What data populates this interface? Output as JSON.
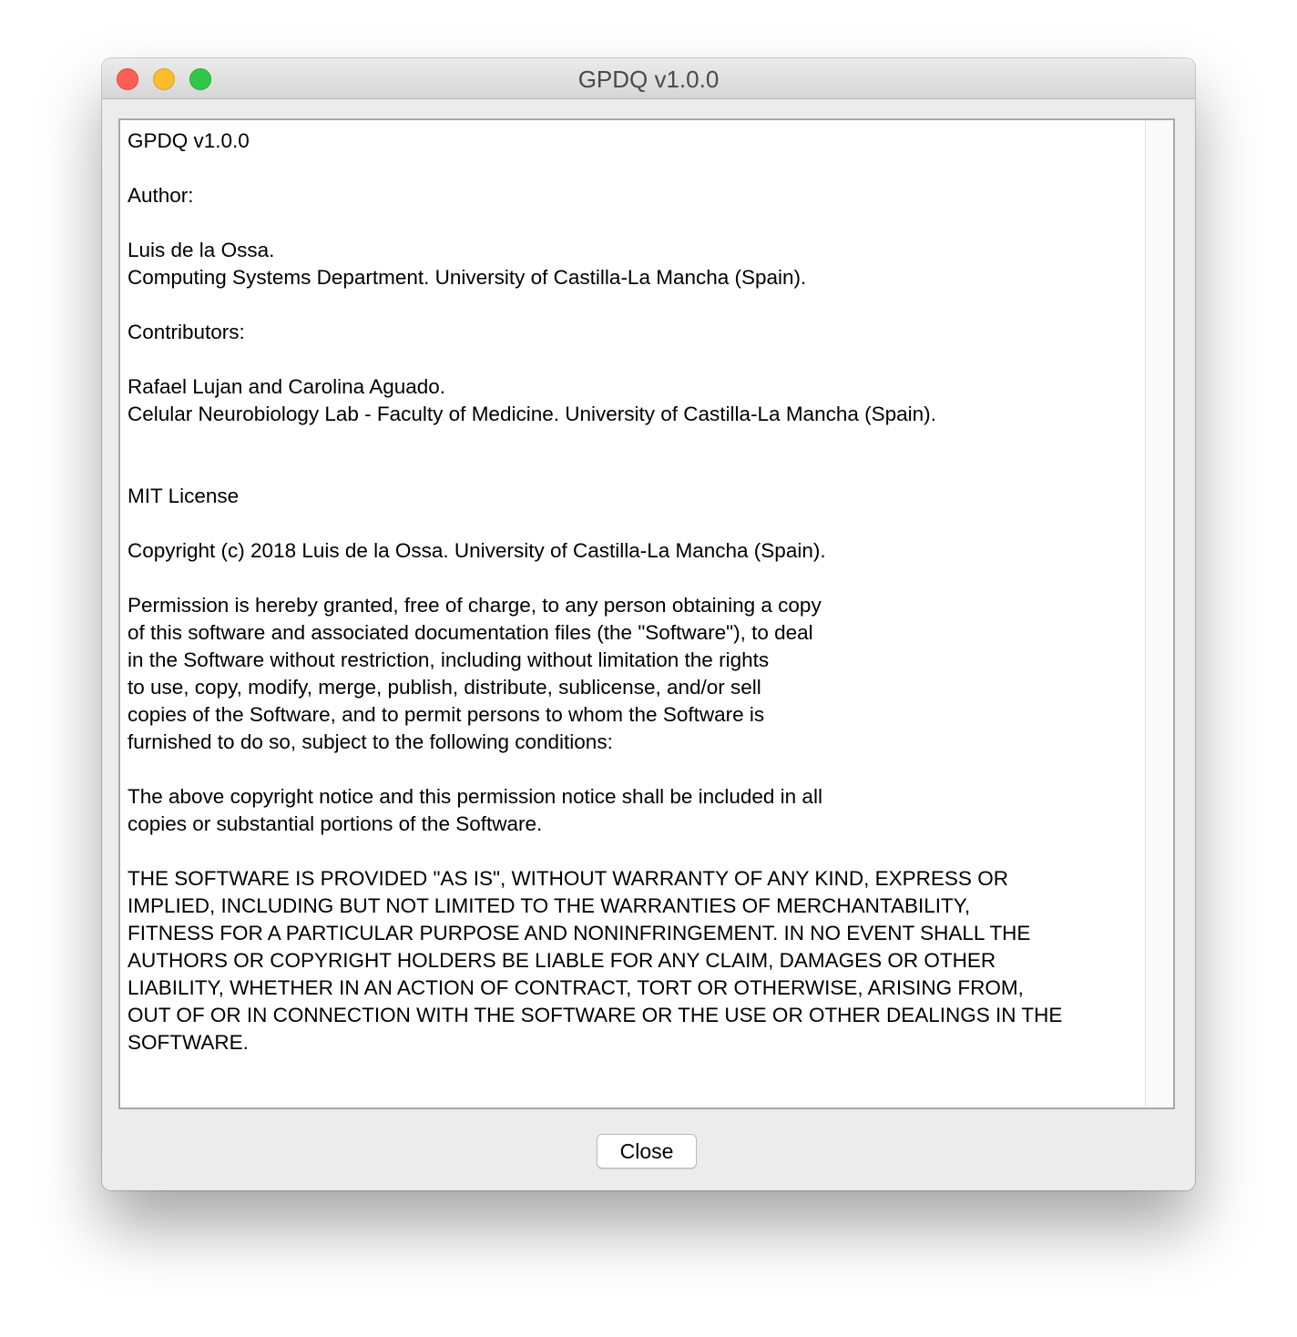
{
  "window": {
    "title": "GPDQ v1.0.0"
  },
  "content": {
    "lines": [
      "GPDQ v1.0.0",
      "",
      "Author:",
      "",
      "Luis de la Ossa.",
      "Computing Systems Department. University of Castilla-La Mancha (Spain).",
      "",
      "Contributors:",
      "",
      "Rafael Lujan and Carolina Aguado.",
      "Celular Neurobiology Lab - Faculty of Medicine. University of Castilla-La Mancha (Spain).",
      "",
      "",
      "MIT License",
      "",
      "Copyright (c) 2018 Luis de la Ossa. University of Castilla-La Mancha (Spain).",
      "",
      "Permission is hereby granted, free of charge, to any person obtaining a copy",
      "of this software and associated documentation files (the \"Software\"), to deal",
      "in the Software without restriction, including without limitation the rights",
      "to use, copy, modify, merge, publish, distribute, sublicense, and/or sell",
      "copies of the Software, and to permit persons to whom the Software is",
      "furnished to do so, subject to the following conditions:",
      "",
      "The above copyright notice and this permission notice shall be included in all",
      "copies or substantial portions of the Software.",
      "",
      "THE SOFTWARE IS PROVIDED \"AS IS\", WITHOUT WARRANTY OF ANY KIND, EXPRESS OR",
      "IMPLIED, INCLUDING BUT NOT LIMITED TO THE WARRANTIES OF MERCHANTABILITY,",
      "FITNESS FOR A PARTICULAR PURPOSE AND NONINFRINGEMENT. IN NO EVENT SHALL THE",
      "AUTHORS OR COPYRIGHT HOLDERS BE LIABLE FOR ANY CLAIM, DAMAGES OR OTHER",
      "LIABILITY, WHETHER IN AN ACTION OF CONTRACT, TORT OR OTHERWISE, ARISING FROM,",
      "OUT OF OR IN CONNECTION WITH THE SOFTWARE OR THE USE OR OTHER DEALINGS IN THE",
      "SOFTWARE."
    ]
  },
  "buttons": {
    "close_label": "Close"
  },
  "colors": {
    "close_light": "#fc5f57",
    "minimize_light": "#fdbc2e",
    "maximize_light": "#33c748"
  }
}
